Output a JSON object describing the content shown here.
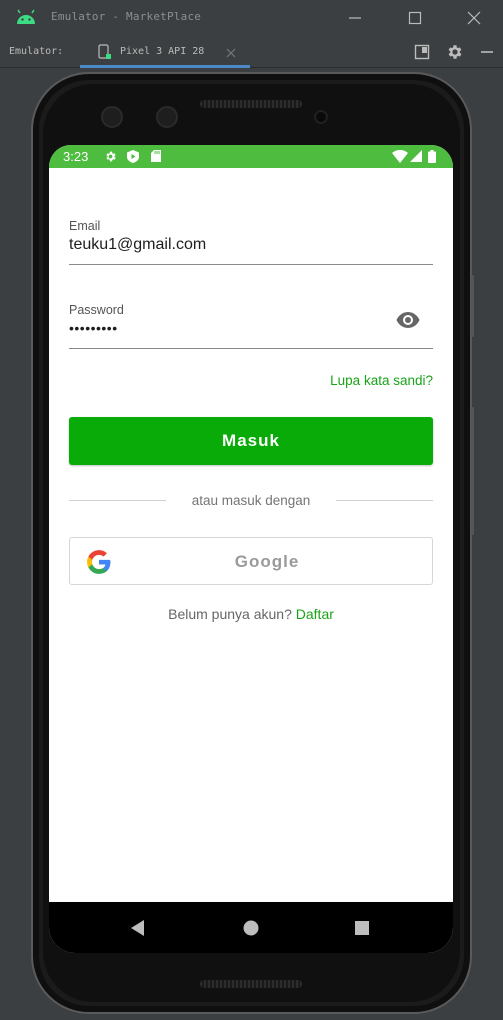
{
  "window": {
    "title": "Emulator - MarketPlace",
    "toolbar_label": "Emulator:",
    "tab_label": "Pixel 3 API 28"
  },
  "colors": {
    "accent_green": "#08ab08",
    "status_bar": "#4ebc3e",
    "link_green": "#1aa31a"
  },
  "statusbar": {
    "time": "3:23",
    "icons": [
      "gear-icon",
      "play-protect-icon",
      "sd-card-icon",
      "wifi-icon",
      "signal-icon",
      "battery-icon"
    ]
  },
  "login": {
    "email_label": "Email",
    "email_value": "teuku1@gmail.com",
    "password_label": "Password",
    "password_value": "•••••••••",
    "forgot_link": "Lupa kata sandi?",
    "login_button": "Masuk",
    "or_text": "atau masuk dengan",
    "google_button": "Google",
    "signup_prompt": "Belum punya akun?",
    "signup_link": "Daftar"
  },
  "navbar": {
    "icons": [
      "back-icon",
      "home-icon",
      "recents-icon"
    ]
  }
}
